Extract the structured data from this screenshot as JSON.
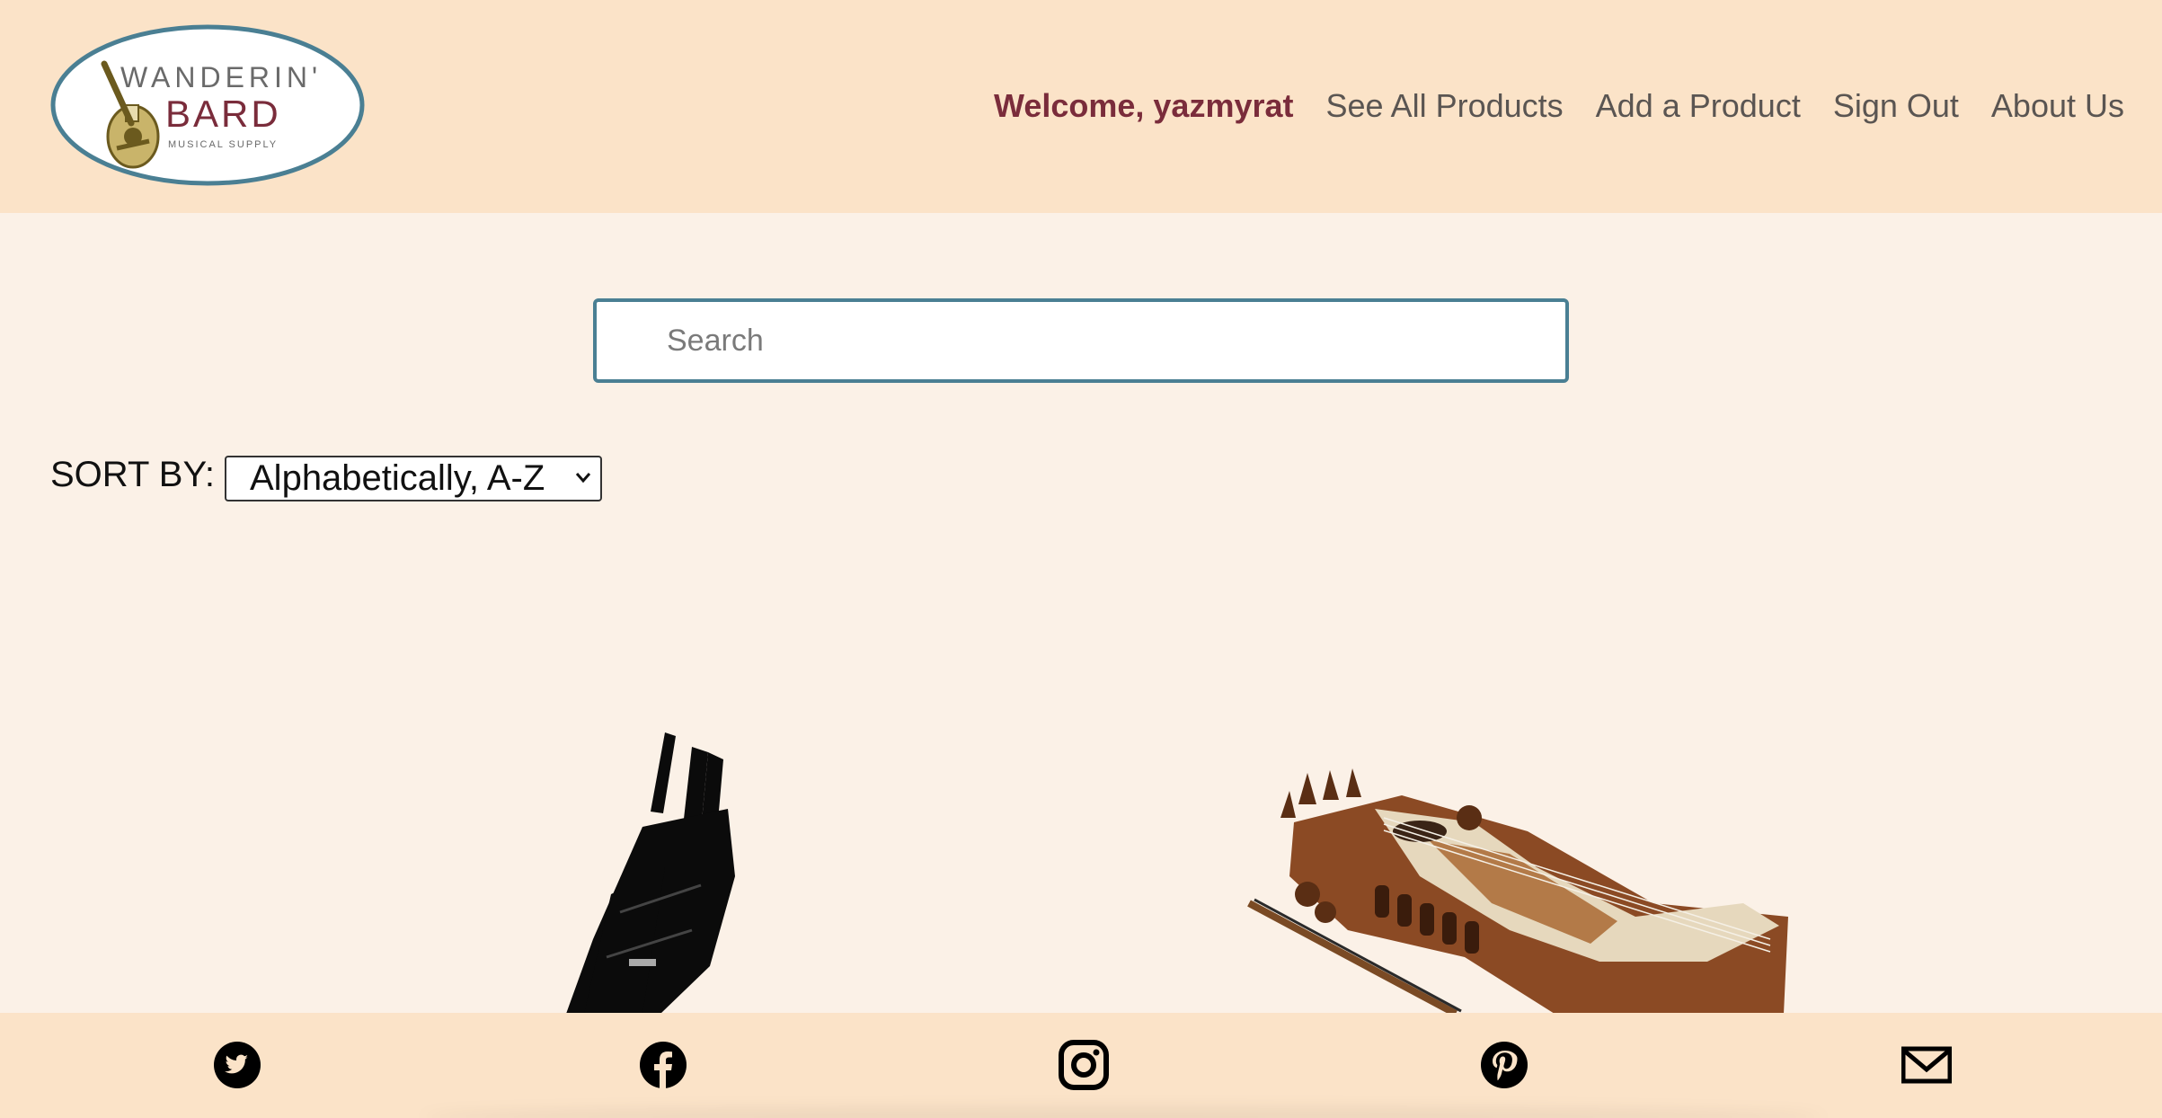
{
  "header": {
    "logo": {
      "line1": "WANDERIN'",
      "line2": "BARD",
      "line3": "MUSICAL SUPPLY"
    },
    "nav": {
      "welcome": "Welcome, yazmyrat",
      "items": [
        "See All Products",
        "Add a Product",
        "Sign Out",
        "About Us"
      ]
    }
  },
  "search": {
    "placeholder": "Search",
    "value": ""
  },
  "sort": {
    "label": "SORT BY:",
    "selected": "Alphabetically, A-Z"
  },
  "products": [
    {
      "icon": "bagpipe-chanter-image"
    },
    {
      "icon": "sarangi-image"
    }
  ],
  "footer": {
    "icons": [
      "twitter-icon",
      "facebook-icon",
      "instagram-icon",
      "pinterest-icon",
      "email-icon"
    ]
  },
  "colors": {
    "header_bg": "#fbe3c8",
    "page_bg": "#fbf1e7",
    "accent_teal": "#4a7f93",
    "brand_maroon": "#7a2c3b",
    "nav_text": "#5a5552"
  }
}
